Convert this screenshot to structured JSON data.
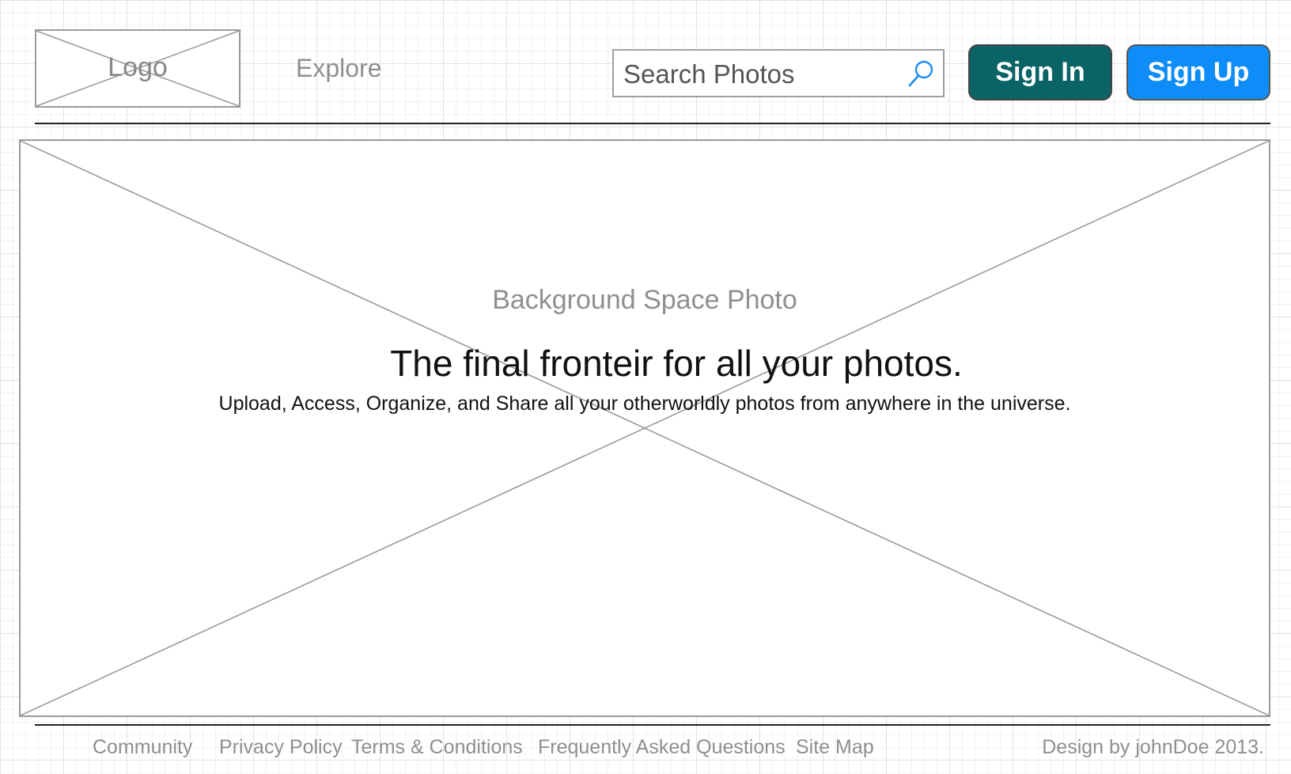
{
  "header": {
    "logo_text": "Logo",
    "nav_explore": "Explore",
    "search": {
      "placeholder": "Search Photos",
      "icon": "search-icon"
    },
    "sign_in_label": "Sign In",
    "sign_up_label": "Sign Up"
  },
  "hero": {
    "background_label": "Background Space Photo",
    "title": "The final fronteir for all your photos.",
    "subtitle": "Upload, Access, Organize, and Share all your otherworldly photos from anywhere in the universe."
  },
  "footer": {
    "links": [
      "Community",
      "Privacy Policy",
      "Terms & Conditions",
      "Frequently Asked Questions",
      "Site Map"
    ],
    "credit": "Design by johnDoe 2013."
  },
  "colors": {
    "sign_in_bg": "#0a6466",
    "sign_up_bg": "#0e8cf7",
    "muted_text": "#8f8f8f",
    "placeholder_border": "#9a9a9a"
  }
}
